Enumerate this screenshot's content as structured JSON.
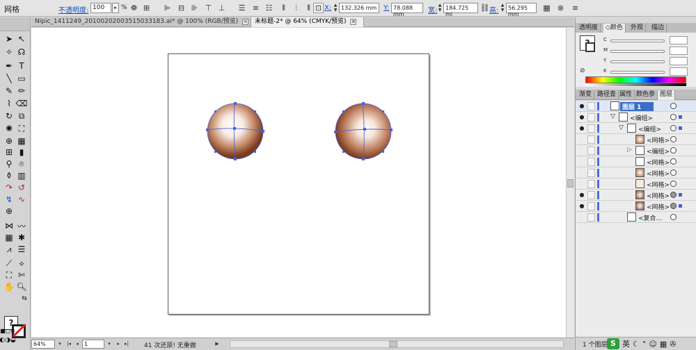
{
  "control_bar": {
    "title": "网格",
    "opacity_label": "不透明度:",
    "opacity_value": "100",
    "percent": "%",
    "x_label": "X:",
    "x_value": "132.326 mm",
    "y_label": "Y:",
    "y_value": "78.088 mm",
    "w_label": "宽:",
    "w_value": "184.725 mi",
    "h_label": "高:",
    "h_value": "56.295 mm"
  },
  "tabs": [
    {
      "label": "Nipic_1411249_20100202003515033183.ai* @ 100% (RGB/预览)",
      "close": "×"
    },
    {
      "label": "未标题-2* @ 64% (CMYK/预览)",
      "close": "×"
    }
  ],
  "status": {
    "zoom": "64%",
    "page": "1",
    "undo_text": "41 次还原! 无重做"
  },
  "color_panel": {
    "tabs": [
      "透明度",
      "◇颜色",
      "外观",
      "描边"
    ],
    "channels": [
      "C",
      "M",
      "Y",
      "K"
    ],
    "fill_glyph": "?"
  },
  "layers_panel": {
    "tabs": [
      "渐变",
      "路径查",
      "属性",
      "颜色参",
      "图层"
    ],
    "rows": [
      {
        "name": "图层 1"
      },
      {
        "name": "<编组>"
      },
      {
        "name": "<编组>"
      },
      {
        "name": "<网格>"
      },
      {
        "name": "<编组>"
      },
      {
        "name": "<网格>"
      },
      {
        "name": "<网格>"
      },
      {
        "name": "<网格>"
      },
      {
        "name": "<网格>"
      },
      {
        "name": "<网格>"
      },
      {
        "name": "<复合..."
      }
    ],
    "footer": "1 个图层"
  },
  "ime": {
    "logo": "S",
    "lang": "英"
  },
  "colors": {
    "accent": "#3a6ec8",
    "sphere_edge": "#7a3a1e",
    "mesh_line": "#4a62d8"
  }
}
